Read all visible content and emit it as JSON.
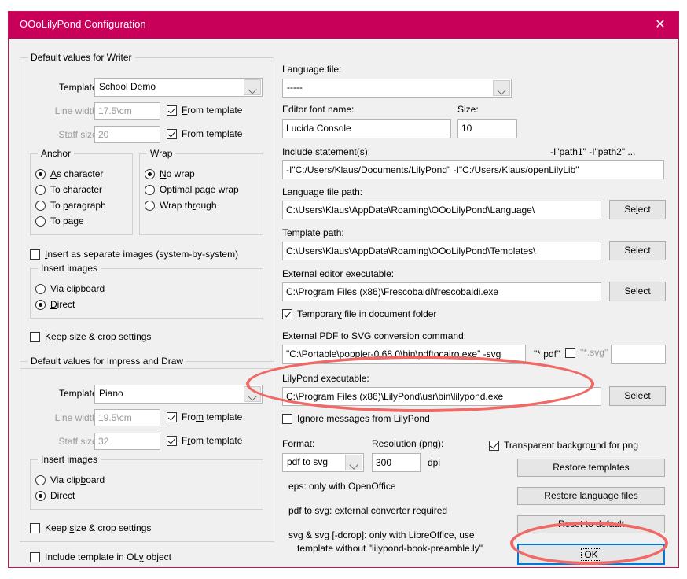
{
  "window": {
    "title": "OOoLilyPond Configuration",
    "close_icon": "close-icon",
    "accent_color": "#c8005a"
  },
  "writer_group": {
    "legend": "Default values for Writer",
    "template_label": "Template:",
    "template_value": "School Demo",
    "line_width_label": "Line width:",
    "line_width_value": "17.5\\cm",
    "line_width_from_template": "From template",
    "staff_size_label": "Staff size:",
    "staff_size_value": "20",
    "staff_size_from_template": "From template",
    "anchor": {
      "legend": "Anchor",
      "options": [
        "As character",
        "To character",
        "To paragraph",
        "To page"
      ],
      "selected": "As character"
    },
    "wrap": {
      "legend": "Wrap",
      "options": [
        "No wrap",
        "Optimal page wrap",
        "Wrap through"
      ],
      "selected": "No wrap"
    },
    "separate_images_label": "Insert as separate images (system-by-system)",
    "separate_images_checked": false,
    "insert_images": {
      "legend": "Insert images",
      "options": [
        "Via clipboard",
        "Direct"
      ],
      "selected": "Direct"
    },
    "keep_size_label": "Keep size & crop settings",
    "keep_size_checked": false
  },
  "impress_group": {
    "legend": "Default values for Impress and Draw",
    "template_label": "Template:",
    "template_value": "Piano",
    "line_width_label": "Line width:",
    "line_width_value": "19.5\\cm",
    "line_width_from_template": "From template",
    "staff_size_label": "Staff size:",
    "staff_size_value": "32",
    "staff_size_from_template": "From template",
    "insert_images": {
      "legend": "Insert images",
      "options": [
        "Via clipboard",
        "Direct"
      ],
      "selected": "Direct"
    },
    "keep_size_label": "Keep size & crop settings",
    "keep_size_checked": false
  },
  "include_template_label": "Include template in OLy object",
  "include_template_checked": false,
  "right": {
    "language_file_label": "Language file:",
    "language_file_value": "-----",
    "editor_font_label": "Editor font name:",
    "editor_font_value": "Lucida Console",
    "size_label": "Size:",
    "size_value": "10",
    "include_statements_label": "Include statement(s):",
    "include_statements_hint": "-I\"path1\" -I\"path2\" ...",
    "include_statements_value": "-I\"C:/Users/Klaus/Documents/LilyPond\"  -I\"C:/Users/Klaus/openLilyLib\"",
    "language_file_path_label": "Language file path:",
    "language_file_path_value": "C:\\Users\\Klaus\\AppData\\Roaming\\OOoLilyPond\\Language\\",
    "language_file_path_select": "Select",
    "template_path_label": "Template path:",
    "template_path_value": "C:\\Users\\Klaus\\AppData\\Roaming\\OOoLilyPond\\Templates\\",
    "template_path_select": "Select",
    "external_editor_label": "External editor executable:",
    "external_editor_value": "C:\\Program Files (x86)\\Frescobaldi\\frescobaldi.exe",
    "external_editor_select": "Select",
    "temp_file_label": "Temporary file in document folder",
    "temp_file_checked": true,
    "pdf2svg_label": "External PDF to SVG conversion command:",
    "pdf2svg_value": "\"C:\\Portable\\poppler-0.68.0\\bin\\pdftocairo.exe\" -svg",
    "pdf_mask": "\"*.pdf\"",
    "svg_mask": "\"*.svg\"",
    "svg_mask_checked": false,
    "svg_extra_value": "",
    "lilypond_exe_label": "LilyPond executable:",
    "lilypond_exe_value": "C:\\Program Files (x86)\\LilyPond\\usr\\bin\\lilypond.exe",
    "lilypond_exe_select": "Select",
    "ignore_messages_label": "Ignore messages from LilyPond",
    "ignore_messages_checked": false,
    "format_label": "Format:",
    "format_value": "pdf to svg",
    "resolution_label": "Resolution (png):",
    "resolution_value": "300",
    "dpi_label": "dpi",
    "note1": "eps: only with OpenOffice",
    "note2": "pdf to svg: external converter required",
    "note3": "svg & svg [-dcrop]: only with LibreOffice, use",
    "note4": "template without \"lilypond-book-preamble.ly\"",
    "transparent_label": "Transparent background for png",
    "transparent_checked": true,
    "restore_templates": "Restore templates",
    "restore_language_files": "Restore language files",
    "reset_to_default": "Reset to default",
    "ok": "OK"
  },
  "annotations": {
    "highlight_color": "#ef6a67",
    "items": [
      "lilypond-executable-ellipse",
      "ok-button-ellipse"
    ]
  }
}
